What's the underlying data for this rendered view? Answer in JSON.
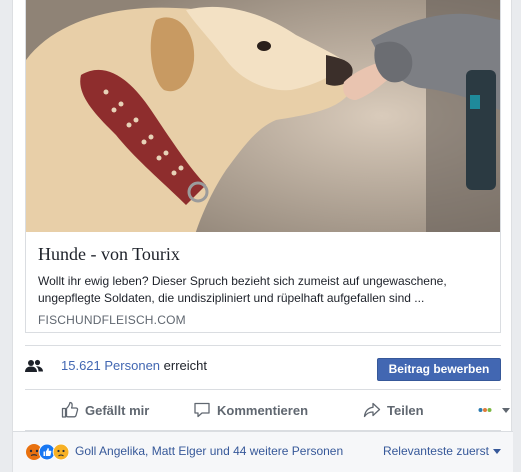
{
  "link_preview": {
    "title": "Hunde - von Tourix",
    "description": "Wollt ihr ewig leben? Dieser Spruch bezieht sich zumeist auf ungewaschene, ungepflegte Soldaten, die undiszipliniert und rüpelhaft aufgefallen sind ...",
    "domain": "FISCHUNDFLEISCH.COM"
  },
  "reach": {
    "count": "15.621 Personen",
    "suffix": "erreicht",
    "icon": "people-icon",
    "boost_label": "Beitrag bewerben"
  },
  "actions": {
    "like_label": "Gefällt mir",
    "comment_label": "Kommentieren",
    "share_label": "Teilen"
  },
  "reactions": {
    "icons": [
      "angry",
      "like",
      "sad"
    ],
    "names": "Goll Angelika, Matt Elger und 44 weitere Personen",
    "sort_label": "Relevanteste zuerst"
  },
  "colors": {
    "brand_blue": "#4267b2",
    "link_blue": "#365899",
    "muted_gray": "#606770"
  }
}
